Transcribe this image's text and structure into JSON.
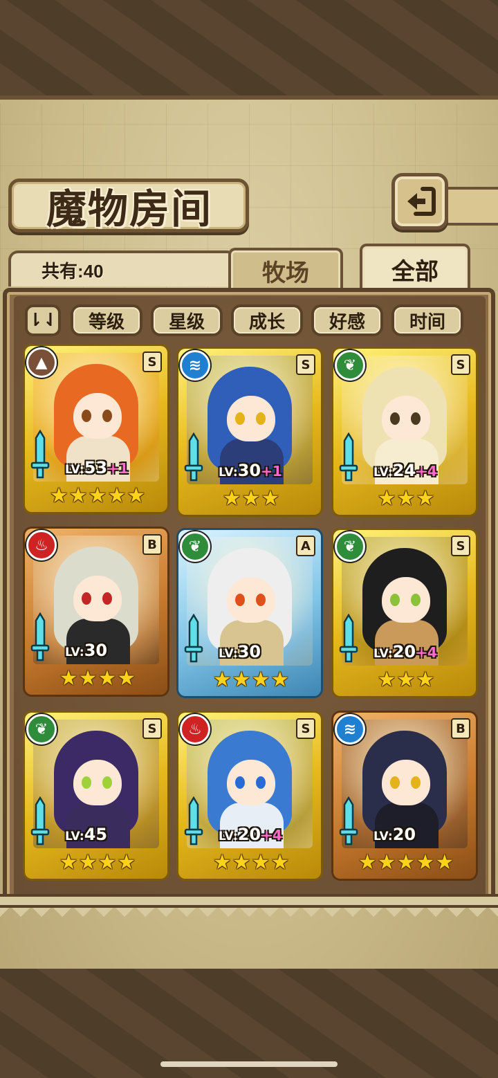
{
  "header": {
    "title": "魔物房间",
    "back_icon": "back-arrow-icon"
  },
  "count": {
    "label": "共有:40"
  },
  "tabs": [
    {
      "label": "牧场",
      "active": false
    },
    {
      "label": "全部",
      "active": true
    }
  ],
  "sort": {
    "toggle_icon": "sort-order-icon",
    "toggle_glyph": "⇂⇃"
  },
  "filters": [
    "等级",
    "星级",
    "成长",
    "好感",
    "时间"
  ],
  "cards": [
    {
      "element": "earth",
      "element_glyph": "▲",
      "rank": "S",
      "level": "53",
      "bonus": "+1",
      "stars": 5,
      "frame": "gold",
      "hair": "#e86a22",
      "eye": "#8a4a1a",
      "body": "#f0e2c8"
    },
    {
      "element": "water",
      "element_glyph": "≋",
      "rank": "S",
      "level": "30",
      "bonus": "+1",
      "stars": 3,
      "frame": "gold",
      "hair": "#2f5fb8",
      "eye": "#e6b21a",
      "body": "#2c3e7a"
    },
    {
      "element": "wood",
      "element_glyph": "❦",
      "rank": "S",
      "level": "24",
      "bonus": "+4",
      "stars": 3,
      "frame": "gold",
      "hair": "#efe2b2",
      "eye": "#4a3a20",
      "body": "#f6ecd0"
    },
    {
      "element": "fire",
      "element_glyph": "♨",
      "rank": "B",
      "level": "30",
      "bonus": "",
      "stars": 4,
      "frame": "bronze",
      "hair": "#dcdccc",
      "eye": "#c22626",
      "body": "#2a2a2a"
    },
    {
      "element": "wood",
      "element_glyph": "❦",
      "rank": "A",
      "level": "30",
      "bonus": "",
      "stars": 4,
      "frame": "silver",
      "hair": "#eeeeee",
      "eye": "#e0501a",
      "body": "#d8c490"
    },
    {
      "element": "wood",
      "element_glyph": "❦",
      "rank": "S",
      "level": "20",
      "bonus": "+4",
      "stars": 3,
      "frame": "gold",
      "hair": "#1e1e1e",
      "eye": "#8cc23a",
      "body": "#c99a5a"
    },
    {
      "element": "wood",
      "element_glyph": "❦",
      "rank": "S",
      "level": "45",
      "bonus": "",
      "stars": 4,
      "frame": "gold",
      "hair": "#3b2a66",
      "eye": "#9fd23a",
      "body": "#3a2c5c"
    },
    {
      "element": "fire",
      "element_glyph": "♨",
      "rank": "S",
      "level": "20",
      "bonus": "+4",
      "stars": 4,
      "frame": "gold",
      "hair": "#3a7ad0",
      "eye": "#2a6ad6",
      "body": "#e8eef6"
    },
    {
      "element": "water",
      "element_glyph": "≋",
      "rank": "B",
      "level": "20",
      "bonus": "",
      "stars": 5,
      "frame": "bronze",
      "hair": "#2a2e4a",
      "eye": "#e6b21a",
      "body": "#1e1e2a"
    }
  ],
  "lv_prefix": "LV:",
  "star_glyph": "★"
}
